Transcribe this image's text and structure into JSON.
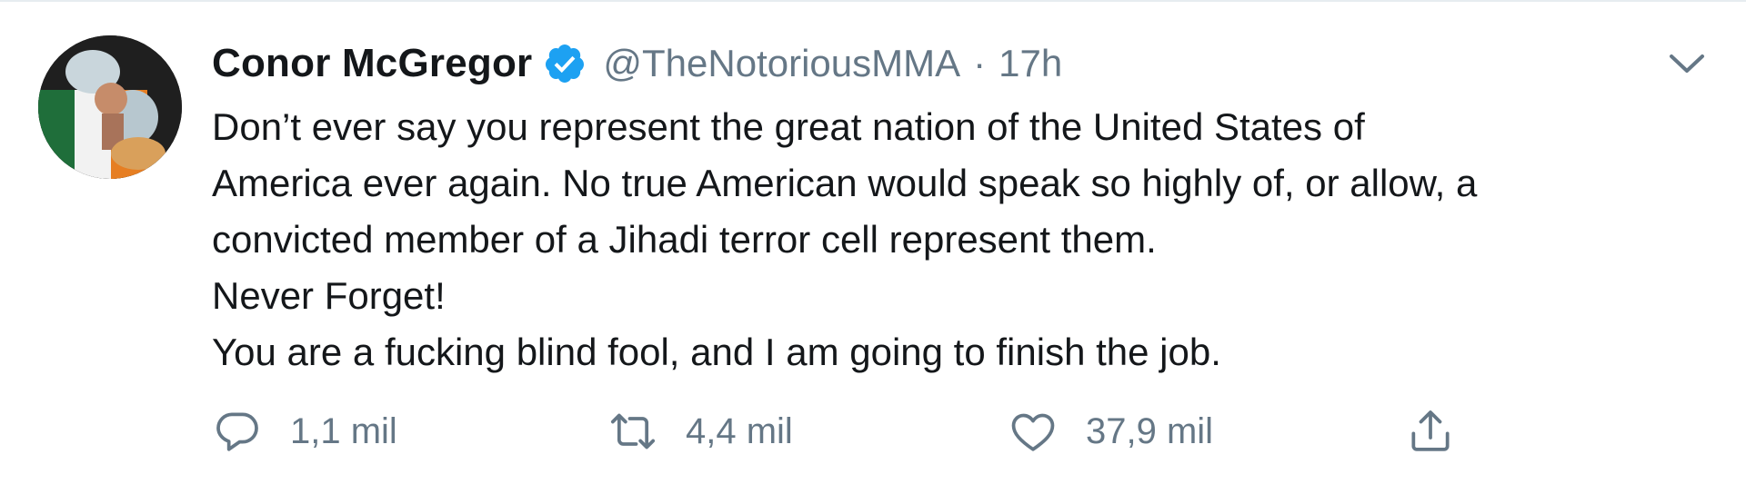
{
  "tweet": {
    "display_name": "Conor McGregor",
    "handle": "@TheNotoriousMMA",
    "separator": "·",
    "time": "17h",
    "text_lines": [
      "Don’t ever say you represent the great nation of the United States of",
      "America ever again. No true American would speak so highly of, or allow, a",
      "convicted member of a Jihadi terror cell represent them.",
      "Never Forget!",
      "You are a fucking blind fool, and I am going to finish the job."
    ],
    "actions": {
      "reply_count": "1,1 mil",
      "retweet_count": "4,4 mil",
      "like_count": "37,9 mil"
    }
  },
  "icons": {
    "verified": "verified-badge-icon",
    "caret": "chevron-down-icon",
    "reply": "reply-icon",
    "retweet": "retweet-icon",
    "like": "heart-icon",
    "share": "share-icon"
  },
  "colors": {
    "verified_blue": "#1da1f2",
    "secondary_text": "#657786",
    "primary_text": "#14171a"
  }
}
